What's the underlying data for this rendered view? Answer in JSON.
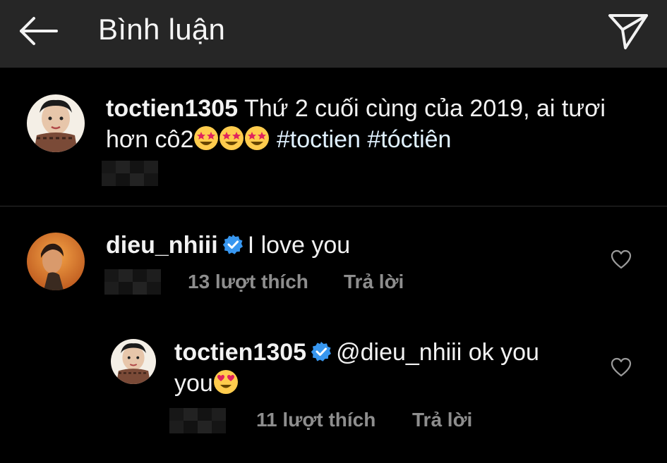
{
  "header": {
    "title": "Bình luận",
    "back_icon": "arrow-left-icon",
    "share_icon": "paper-plane-icon"
  },
  "caption": {
    "username": "toctien1305",
    "text": "Thứ 2 cuối cùng của 2019, ai tươi hơn cô2",
    "text_part2": "hơn cô2",
    "text_part1": "Thứ 2 cuối cùng của 2019, ai tươi",
    "hashtags": "#toctien #tóctiên"
  },
  "comments": [
    {
      "username": "dieu_nhiii",
      "verified": true,
      "text": "I love you",
      "likes": "13 lượt thích",
      "reply_label": "Trả lời"
    }
  ],
  "reply": {
    "username": "toctien1305",
    "verified": true,
    "text_line1": "@dieu_nhiii ok you",
    "text_line2": "you",
    "likes": "11 lượt thích",
    "reply_label": "Trả lời"
  },
  "colors": {
    "header_bg": "#262626",
    "background": "#000000",
    "verified_blue": "#3897f0",
    "meta_gray": "#8e8e8e"
  }
}
